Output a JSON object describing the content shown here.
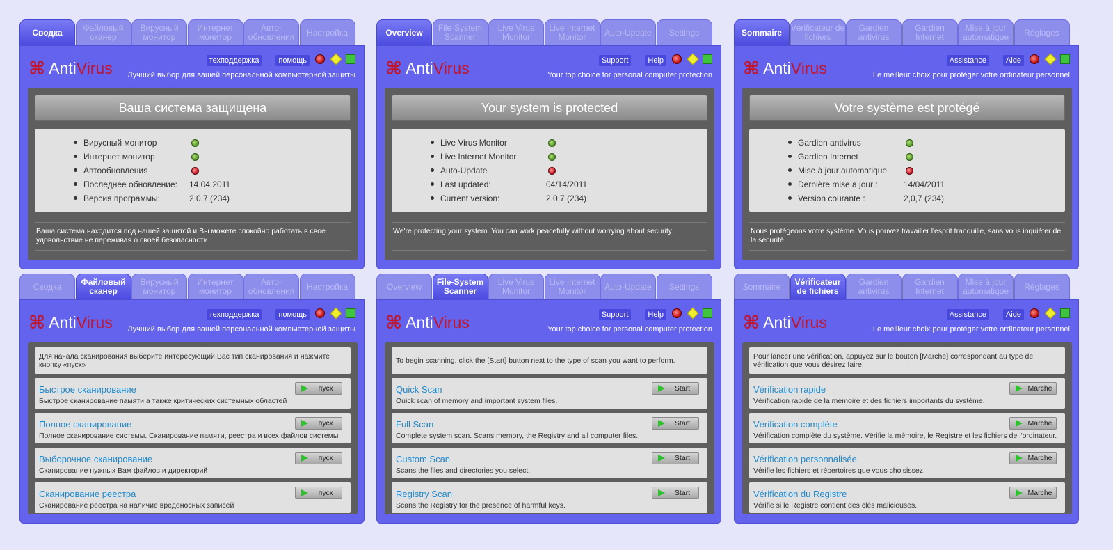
{
  "panels": [
    {
      "lang": "ru",
      "kind": "overview",
      "active_tab": 0,
      "tabs": [
        "Сводка",
        "Файловый\nсканер",
        "Вирусный\nмонитор",
        "Интернет\nмонитор",
        "Авто-\nобновления",
        "Настройка"
      ],
      "support": "техподдержка",
      "help": "помощь",
      "logo": {
        "anti": "Anti",
        "virus": "Virus",
        "icon": "command-key-icon"
      },
      "tagline": "Лучший выбор для вашей персональной компьютерной защиты",
      "banner": "Ваша система защищена",
      "status": [
        {
          "label": "Вирусный монитор",
          "led": "ok"
        },
        {
          "label": "Интернет монитор",
          "led": "ok"
        },
        {
          "label": "Автообновления",
          "led": "bad"
        },
        {
          "label": "Последнее обновление:",
          "value": "14.04.2011"
        },
        {
          "label": "Версия программы:",
          "value": "2.0.7 (234)"
        }
      ],
      "message": "Ваша система находится под нашей защитой и Вы можете спокойно работать в свое удовольствие не переживая о своей безопасности."
    },
    {
      "lang": "en",
      "kind": "overview",
      "active_tab": 0,
      "tabs": [
        "Overview",
        "File-System\nScanner",
        "Live Virus\nMonitor",
        "Live Internet\nMonitor",
        "Auto-Update",
        "Settings"
      ],
      "support": "Support",
      "help": "Help",
      "logo": {
        "anti": "Anti",
        "virus": "Virus",
        "icon": "command-key-icon"
      },
      "tagline": "Your top choice for personal computer protection",
      "banner": "Your system is protected",
      "status": [
        {
          "label": "Live Virus Monitor",
          "led": "ok"
        },
        {
          "label": "Live Internet Monitor",
          "led": "ok"
        },
        {
          "label": "Auto-Update",
          "led": "bad"
        },
        {
          "label": "Last updated:",
          "value": "04/14/2011"
        },
        {
          "label": "Current version:",
          "value": "2.0.7 (234)"
        }
      ],
      "message": "We're protecting your system. You can work peacefully without worrying about security."
    },
    {
      "lang": "fr",
      "kind": "overview",
      "active_tab": 0,
      "tabs": [
        "Sommaire",
        "Vérificateur de\nfichiers",
        "Gardien\nantivirus",
        "Gardien\nInternet",
        "Mise à jour\nautomatique",
        "Réglages"
      ],
      "support": "Assistance",
      "help": "Aide",
      "logo": {
        "anti": "Anti",
        "virus": "Virus",
        "icon": "command-key-icon"
      },
      "tagline": "Le meilleur choix pour protéger votre ordinateur personnel",
      "banner": "Votre système est protégé",
      "status": [
        {
          "label": "Gardien antivirus",
          "led": "ok"
        },
        {
          "label": "Gardien Internet",
          "led": "ok"
        },
        {
          "label": "Mise à jour automatique",
          "led": "bad"
        },
        {
          "label": "Dernière mise à jour :",
          "value": "14/04/2011"
        },
        {
          "label": "Version courante :",
          "value": "2,0,7 (234)"
        }
      ],
      "message": "Nous protégeons  votre système. Vous pouvez travailler l'esprit tranquille, sans vous inquiéter de la sécurité."
    },
    {
      "lang": "ru",
      "kind": "scanner",
      "active_tab": 1,
      "tabs": [
        "Сводка",
        "Файловый\nсканер",
        "Вирусный\nмонитор",
        "Интернет\nмонитор",
        "Авто-\nобновления",
        "Настройка"
      ],
      "support": "техподдержка",
      "help": "помощь",
      "logo": {
        "anti": "Anti",
        "virus": "Virus",
        "icon": "command-key-icon"
      },
      "tagline": "Лучший выбор для вашей персональной компьютерной защиты",
      "intro": "Для начала сканирования выберите интересующий Вас тип сканирования и нажмите кнопку «пуск»",
      "start_label": "пуск",
      "scans": [
        {
          "title": "Быстрое сканирование",
          "desc": "Быстрое сканирование памяти а также критических системных областей"
        },
        {
          "title": "Полное сканирование",
          "desc": "Полное сканирование системы. Сканирование памяти, реестра и всех файлов системы"
        },
        {
          "title": "Выборочное сканирование",
          "desc": "Сканирование нужных Вам файлов и директорий"
        },
        {
          "title": "Сканирование реестра",
          "desc": "Сканирование реестра на наличие вредоносных записей"
        }
      ]
    },
    {
      "lang": "en",
      "kind": "scanner",
      "active_tab": 1,
      "tabs": [
        "Overview",
        "File-System\nScanner",
        "Live Virus\nMonitor",
        "Live Internet\nMonitor",
        "Auto-Update",
        "Settings"
      ],
      "support": "Support",
      "help": "Help",
      "logo": {
        "anti": "Anti",
        "virus": "Virus",
        "icon": "command-key-icon"
      },
      "tagline": "Your top choice for personal computer protection",
      "intro": "To begin scanning, click the [Start] button next to the type of scan you want to perform.",
      "start_label": "Start",
      "scans": [
        {
          "title": "Quick Scan",
          "desc": "Quick scan of memory and important system files."
        },
        {
          "title": "Full Scan",
          "desc": "Complete system scan. Scans memory, the Registry and all computer files."
        },
        {
          "title": "Custom Scan",
          "desc": "Scans the files and directories you select."
        },
        {
          "title": "Registry Scan",
          "desc": "Scans the Registry for the presence of harmful keys."
        }
      ]
    },
    {
      "lang": "fr",
      "kind": "scanner",
      "active_tab": 1,
      "tabs": [
        "Sommaire",
        "Vérificateur\nde fichiers",
        "Gardien\nantivirus",
        "Gardien\nInternet",
        "Mise à jour\nautomatique",
        "Réglages"
      ],
      "support": "Assistance",
      "help": "Aide",
      "logo": {
        "anti": "Anti",
        "virus": "Virus",
        "icon": "command-key-icon"
      },
      "tagline": "Le meilleur choix pour protéger votre ordinateur personnel",
      "intro": "Pour lancer une vérification, appuyez sur le bouton [Marche] correspondant au type de vérification que vous désirez faire.",
      "start_label": "Marche",
      "scans": [
        {
          "title": "Vérification rapide",
          "desc": "Vérification rapide de la mémoire et des fichiers importants du système."
        },
        {
          "title": "Vérification complète",
          "desc": "Vérification complète du système. Vérifie la mémoire, le Registre et les fichiers de l'ordinateur."
        },
        {
          "title": "Vérification personnalisée",
          "desc": "Vérifie les fichiers et répertoires que vous choisissez."
        },
        {
          "title": "Vérification du Registre",
          "desc": "Vérifie si le Registre contient des clés malicieuses."
        }
      ]
    }
  ]
}
